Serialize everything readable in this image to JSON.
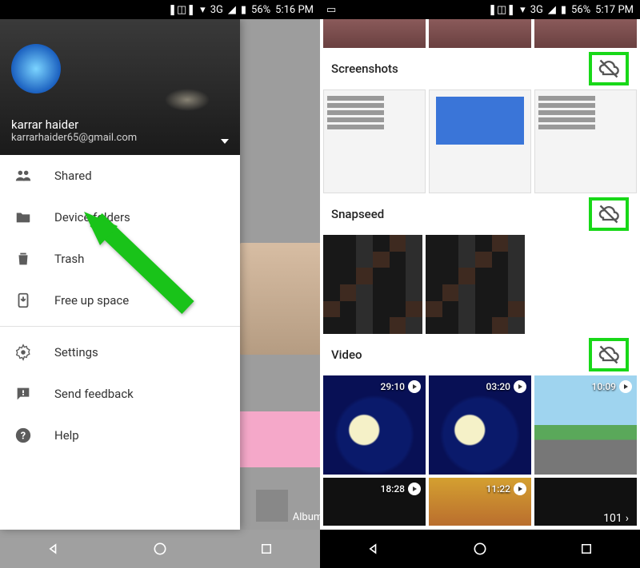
{
  "status": {
    "network": "3G",
    "battery": "56%",
    "time_left": "5:16 PM",
    "time_right": "5:17 PM"
  },
  "account": {
    "name": "karrar haider",
    "email": "karrarhaider65@gmail.com"
  },
  "menu": {
    "shared": "Shared",
    "device_folders": "Device folders",
    "trash": "Trash",
    "free_up": "Free up space",
    "settings": "Settings",
    "feedback": "Send feedback",
    "help": "Help"
  },
  "albums_label": "Albums",
  "sections": {
    "screenshots": "Screenshots",
    "snapseed": "Snapseed",
    "video": "Video"
  },
  "videos": {
    "v1": "29:10",
    "v2": "03:20",
    "v3": "10:09",
    "v4": "18:28",
    "v5": "11:22"
  },
  "page_indicator": "101"
}
